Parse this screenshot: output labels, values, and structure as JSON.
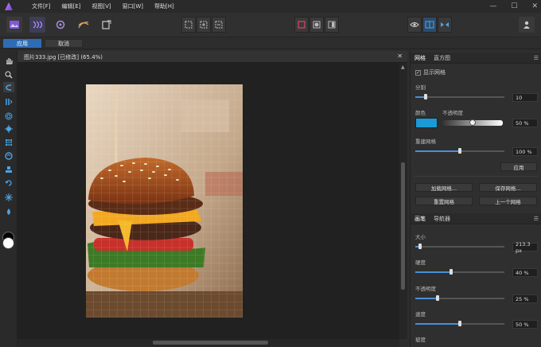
{
  "menubar": {
    "items": [
      "文件[F]",
      "编辑[E]",
      "视图[V]",
      "窗口[W]",
      "帮助[H]"
    ],
    "minimize": "—",
    "maximize": "☐",
    "close": "✕"
  },
  "options": {
    "apply": "应用",
    "cancel": "取消"
  },
  "document": {
    "title": "图片333.jpg [已修改] (65.4%)",
    "close": "✕"
  },
  "grid_panel": {
    "tabs": [
      "网格",
      "直方图"
    ],
    "show_grid": "显示网格",
    "divisions_label": "分割",
    "divisions_value": "10",
    "divisions_level": 0.12,
    "color_label": "颜色",
    "opacity_label": "不透明度",
    "opacity_value": "50 %",
    "opacity_level": 0.5,
    "color_hex": "#1a9ad6",
    "reset_grid_label": "重建网格",
    "reset_grid_value": "100 %",
    "reset_grid_level": 0.5,
    "apply": "应用",
    "load_grid": "加载网格...",
    "save_grid": "保存网格...",
    "reset_grid_btn": "重置网格",
    "prev_grid": "上一个网格"
  },
  "brush_panel": {
    "tabs": [
      "画笔",
      "导航器"
    ],
    "size_label": "大小",
    "size_value": "213.3 px",
    "size_level": 0.05,
    "hardness_label": "硬度",
    "hardness_value": "40 %",
    "hardness_level": 0.4,
    "opacity_label": "不透明度",
    "opacity_value": "25 %",
    "opacity_level": 0.25,
    "flow_label": "速度",
    "flow_value": "50 %",
    "flow_level": 0.5,
    "last_label": "玻度"
  },
  "accent": "#2e6cb5"
}
